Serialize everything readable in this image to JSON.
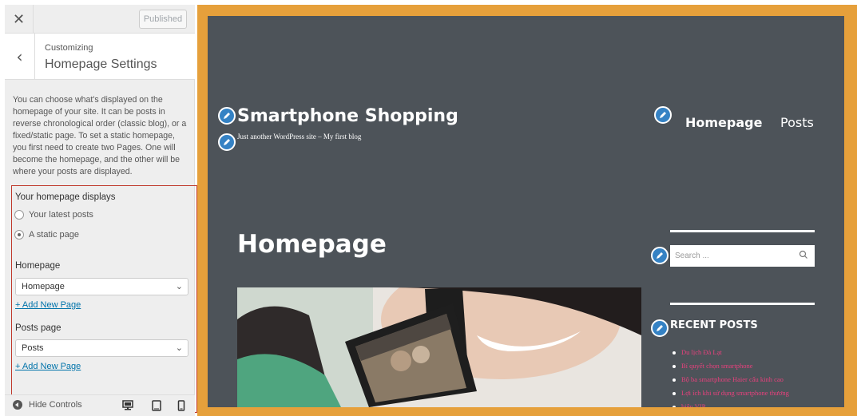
{
  "sidebar": {
    "published_label": "Published",
    "customizing_label": "Customizing",
    "section_title": "Homepage Settings",
    "description": "You can choose what's displayed on the homepage of your site. It can be posts in reverse chronological order (classic blog), or a fixed/static page. To set a static homepage, you first need to create two Pages. One will become the homepage, and the other will be where your posts are displayed.",
    "homepage_displays_label": "Your homepage displays",
    "options": [
      "Your latest posts",
      "A static page"
    ],
    "selected_option": "A static page",
    "homepage_label": "Homepage",
    "homepage_value": "Homepage",
    "add_new_page_1": "+ Add New Page",
    "posts_page_label": "Posts page",
    "posts_page_value": "Posts",
    "add_new_page_2": "+ Add New Page",
    "hide_controls_label": "Hide Controls"
  },
  "preview": {
    "site_title": "Smartphone Shopping",
    "tagline": "Just another WordPress site – My first blog",
    "nav": [
      "Homepage",
      "Posts"
    ],
    "page_title": "Homepage",
    "search_placeholder": "Search ...",
    "recent_posts_title": "RECENT POSTS",
    "recent_posts": [
      "Du lịch Đà Lạt",
      "Bí quyết chọn smartphone",
      "Bộ ba smartphone Haier cấu kinh cao",
      "Lợi ích khi sử dụng smartphone thương",
      "hiệu VIP"
    ]
  },
  "colors": {
    "frame": "#e6a03b",
    "preview_bg": "#4d5359",
    "edit_shortcut": "#3582c4",
    "link": "#0073aa",
    "recent_post_link": "#e8417d",
    "highlight_border": "#c0392b"
  }
}
